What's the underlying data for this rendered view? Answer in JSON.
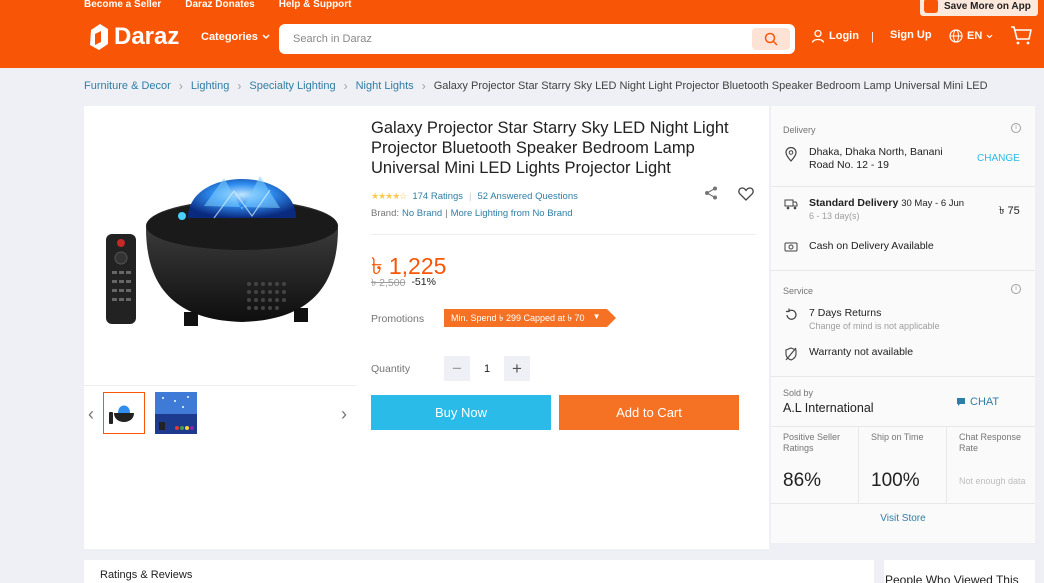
{
  "header": {
    "top_links": [
      "Become a Seller",
      "Daraz Donates",
      "Help & Support"
    ],
    "app_button": "Save More on App",
    "logo_text": "Daraz",
    "categories": "Categories",
    "search_placeholder": "Search in Daraz",
    "login": "Login",
    "signup": "Sign Up",
    "language": "EN",
    "separator": "|",
    "brand_color": "#f85606"
  },
  "breadcrumb": {
    "items": [
      "Furniture & Decor",
      "Lighting",
      "Specialty Lighting",
      "Night Lights"
    ],
    "current": "Galaxy Projector Star Starry Sky LED Night Light Projector Bluetooth Speaker Bedroom Lamp Universal Mini LED"
  },
  "product": {
    "title": "Galaxy Projector Star Starry Sky LED Night Light Projector Bluetooth Speaker Bedroom Lamp Universal Mini LED Lights Projector Light",
    "ratings": "174 Ratings",
    "questions": "52 Answered Questions",
    "brand_label": "Brand:",
    "brand": "No Brand",
    "more_from": "More Lighting from No Brand",
    "price": "৳ 1,225",
    "original_price": "৳ 2,500",
    "discount": "-51%",
    "promotions_label": "Promotions",
    "promotion": "Min. Spend ৳ 299 Capped at ৳ 70",
    "quantity_label": "Quantity",
    "quantity": "1",
    "buy_now": "Buy Now",
    "add_to_cart": "Add to Cart",
    "thumbnail_count": 2
  },
  "delivery": {
    "heading": "Delivery",
    "location_line1": "Dhaka, Dhaka North, Banani",
    "location_line2": "Road No. 12 - 19",
    "change": "CHANGE",
    "standard": "Standard Delivery",
    "dates": "30 May - 6 Jun",
    "days": "6 - 13 day(s)",
    "fee": "৳ 75",
    "cod": "Cash on Delivery Available"
  },
  "service": {
    "heading": "Service",
    "returns": "7 Days Returns",
    "returns_note": "Change of mind is not applicable",
    "warranty": "Warranty not available"
  },
  "seller": {
    "sold_by": "Sold by",
    "name": "A.L International",
    "chat": "CHAT",
    "stats": [
      {
        "label": "Positive Seller Ratings",
        "value": "86%"
      },
      {
        "label": "Ship on Time",
        "value": "100%"
      },
      {
        "label": "Chat Response Rate",
        "value": "Not enough data"
      }
    ],
    "visit_store": "Visit Store"
  },
  "bottom": {
    "ratings_reviews": "Ratings & Reviews",
    "people_viewed": "People Who Viewed This"
  }
}
